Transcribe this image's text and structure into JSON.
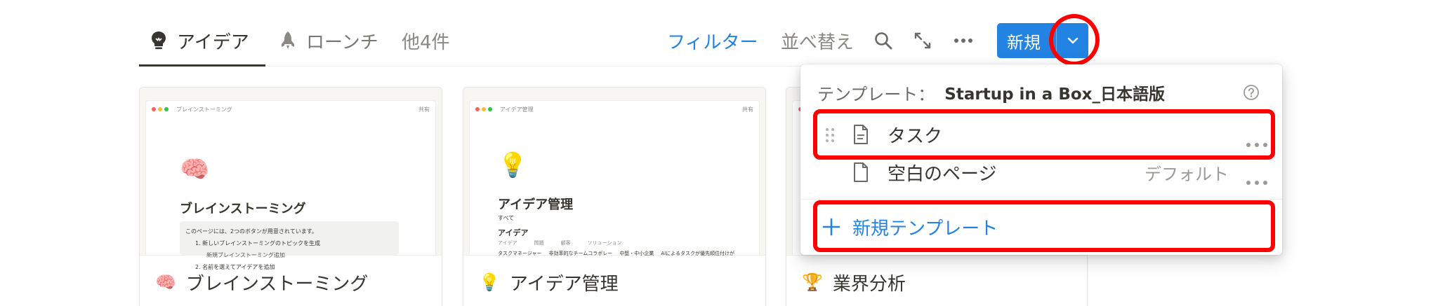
{
  "tabs": [
    {
      "label": "アイデア",
      "icon": "lightbulb-icon",
      "active": true
    },
    {
      "label": "ローンチ",
      "icon": "rocket-icon",
      "active": false
    },
    {
      "label": "他4件",
      "active": false
    }
  ],
  "toolbar": {
    "filter_label": "フィルター",
    "sort_label": "並べ替え",
    "new_label": "新規",
    "accent": "#2383e2"
  },
  "cards": [
    {
      "title": "ブレインストーミング",
      "emoji": "🧠",
      "preview": {
        "crumb": "ブレインストーミング",
        "share": "共有",
        "heading": "ブレインストーミング",
        "callout": "このページには、2つのボタンが用意されています。",
        "step1": "1. 新しいブレインストーミングのトピックを生成",
        "step1_button": "新規ブレインストーミング追加",
        "step2": "2. 名前を選えてアイデアを追加"
      }
    },
    {
      "title": "アイデア管理",
      "emoji": "💡",
      "preview": {
        "crumb": "アイデア管理",
        "share": "共有",
        "heading": "アイデア管理",
        "view": "すべて",
        "section": "アイデア",
        "col1": "アイデア",
        "col2": "問題",
        "col3": "顧客",
        "col4": "ソリューション",
        "row_name": "タスクマネージャー",
        "row_problem": "非効率的なチームコラボレー",
        "row_customer": "中堅・中小企業",
        "row_solution": "AIによるタスクが優先順位付けが"
      }
    },
    {
      "title": "業界分析",
      "emoji": "🏆"
    }
  ],
  "dropdown": {
    "header_prefix": "テンプレート：",
    "template_name": "Startup in a Box_日本語版",
    "items": [
      {
        "label": "タスク"
      },
      {
        "label": "空白のページ",
        "badge": "デフォルト"
      }
    ],
    "new_template_label": "新規テンプレート"
  },
  "annotation_color": "#ff0000"
}
